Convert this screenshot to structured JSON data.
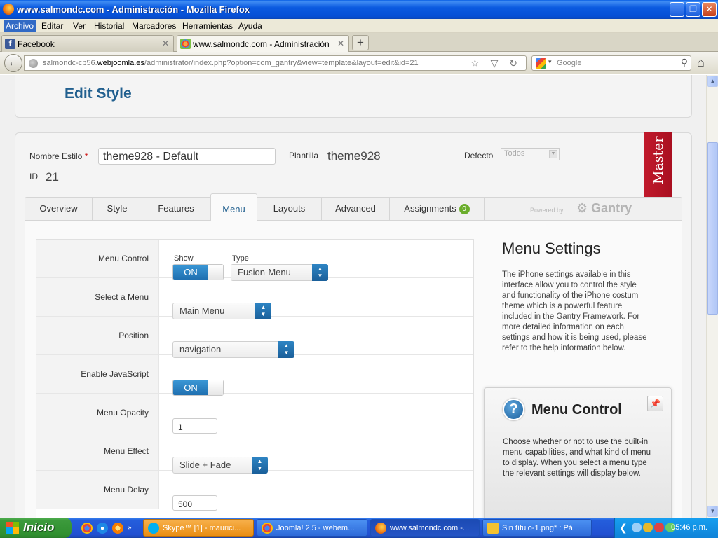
{
  "window": {
    "title": "www.salmondc.com - Administración - Mozilla Firefox",
    "controls": [
      "_",
      "❐",
      "✕"
    ]
  },
  "menubar": [
    "Archivo",
    "Editar",
    "Ver",
    "Historial",
    "Marcadores",
    "Herramientas",
    "Ayuda"
  ],
  "tabs": [
    {
      "label": "Facebook",
      "icon": "facebook-icon"
    },
    {
      "label": "www.salmondc.com - Administración",
      "icon": "joomla-icon"
    }
  ],
  "nav": {
    "url_prefix": "salmondc-cp56.",
    "url_domain": "webjoomla.es",
    "url_path": "/administrator/index.php?option=com_gantry&view=template&layout=edit&id=21",
    "url_icons": "☆ ▽ ↻",
    "search_placeholder": "Google",
    "search_engine_dropdown": "▾",
    "back_glyph": "←",
    "home_glyph": "⌂",
    "search_glyph": "⚲"
  },
  "page": {
    "heading": "Edit Style",
    "fields": {
      "name_label": "Nombre Estilo",
      "required_mark": "*",
      "name_value": "theme928 - Default",
      "template_label": "Plantilla",
      "template_value": "theme928",
      "default_label": "Defecto",
      "default_value": "Todos",
      "id_label": "ID",
      "id_value": "21"
    },
    "master_ribbon": "Master",
    "tabs": [
      "Overview",
      "Style",
      "Features",
      "Menu",
      "Layouts",
      "Advanced",
      "Assignments"
    ],
    "active_tab": "Menu",
    "assignments_count": "0",
    "powered_by": "Powered by",
    "gantry_logo": "Gantry",
    "form": {
      "menu_control": {
        "label": "Menu Control",
        "show_label": "Show",
        "type_label": "Type",
        "show_value": "ON",
        "type_value": "Fusion-Menu"
      },
      "select_menu": {
        "label": "Select a Menu",
        "value": "Main Menu"
      },
      "position": {
        "label": "Position",
        "value": "navigation"
      },
      "enable_js": {
        "label": "Enable JavaScript",
        "value": "ON"
      },
      "opacity": {
        "label": "Menu Opacity",
        "value": "1"
      },
      "effect": {
        "label": "Menu Effect",
        "value": "Slide + Fade"
      },
      "delay": {
        "label": "Menu Delay",
        "value": "500"
      }
    },
    "sidebar": {
      "title": "Menu Settings",
      "description": "The iPhone settings available in this interface allow you to control the style and functionality of the iPhone costum theme which is a powerful feature included in the Gantry Framework. For more detailed information on each settings and how it is being used, please refer to the help information below."
    },
    "help": {
      "title": "Menu Control",
      "description": "Choose whether or not to use the built-in menu capabilities, and what kind of menu to display. When you select a menu type the relevant settings will display below."
    }
  },
  "taskbar": {
    "start_label": "Inicio",
    "items": [
      {
        "label": "Skype™ [1] - maurici...",
        "icon": "skype-icon"
      },
      {
        "label": "Joomla! 2.5 - webem...",
        "icon": "chrome-icon"
      },
      {
        "label": "www.salmondc.com -...",
        "icon": "firefox-icon"
      },
      {
        "label": "Sin título-1.png* : Pá...",
        "icon": "fireworks-icon"
      }
    ],
    "clock": "05:46 p.m."
  }
}
